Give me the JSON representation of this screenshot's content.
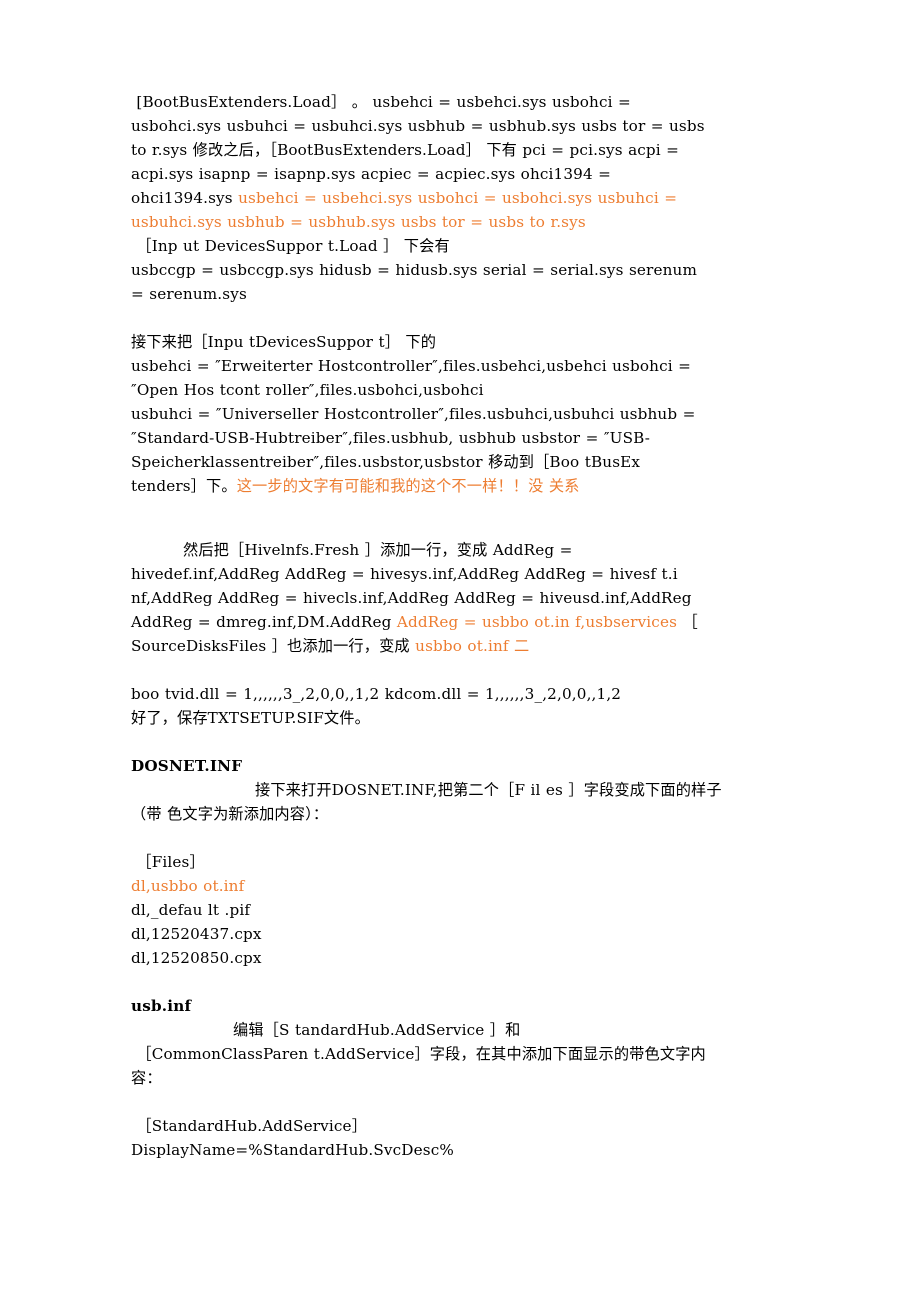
{
  "document": {
    "colors": {
      "text": "#000000",
      "highlight_orange": "#ED7D31",
      "background": "#FFFFFF"
    },
    "blocks": [
      {
        "id": "p1",
        "type": "paragraph",
        "lines": [
          {
            "runs": [
              {
                "text": " [BootBusExtenders.Load］ 。 usbehci = usbehci.sys usbohci =",
                "color": "text"
              }
            ]
          },
          {
            "runs": [
              {
                "text": "usbohci.sys usbuhci = usbuhci.sys usbhub = usbhub.sys usbs tor = usbs",
                "color": "text"
              }
            ]
          },
          {
            "runs": [
              {
                "text": "to r.sys 修改之后，［BootBusExtenders.Load］ 下有 pci = pci.sys acpi =",
                "color": "text"
              }
            ]
          },
          {
            "runs": [
              {
                "text": "acpi.sys isapnp = isapnp.sys acpiec = acpiec.sys ohci1394 =",
                "color": "text"
              }
            ]
          },
          {
            "runs": [
              {
                "text": "ohci1394.sys ",
                "color": "text"
              },
              {
                "text": "usbehci = usbehci.sys usbohci = usbohci.sys usbuhci =",
                "color": "highlight"
              }
            ]
          },
          {
            "runs": [
              {
                "text": "usbuhci.sys usbhub = usbhub.sys usbs tor = usbs to r.sys",
                "color": "highlight"
              }
            ]
          },
          {
            "runs": [
              {
                "text": " ［Inp ut DevicesSuppor t.Load ］ 下会有",
                "color": "text"
              }
            ]
          },
          {
            "runs": [
              {
                "text": "usbccgp = usbccgp.sys hidusb = hidusb.sys serial = serial.sys serenum",
                "color": "text"
              }
            ]
          },
          {
            "runs": [
              {
                "text": "= serenum.sys",
                "color": "text"
              }
            ]
          }
        ]
      },
      {
        "id": "p2",
        "type": "paragraph",
        "lines": [
          {
            "runs": [
              {
                "text": "接下来把［Inpu tDevicesSuppor t］ 下的",
                "color": "text"
              }
            ]
          },
          {
            "runs": [
              {
                "text": "usbehci = ″Erweiterter Hostcontroller″,files.usbehci,usbehci usbohci =",
                "color": "text"
              }
            ]
          },
          {
            "runs": [
              {
                "text": "″Open Hos tcont roller″,files.usbohci,usbohci",
                "color": "text"
              }
            ]
          },
          {
            "runs": [
              {
                "text": "usbuhci = ″Universeller Hostcontroller″,files.usbuhci,usbuhci usbhub =",
                "color": "text"
              }
            ]
          },
          {
            "runs": [
              {
                "text": "″Standard-USB-Hubtreiber″,files.usbhub, usbhub usbstor = ″USB-",
                "color": "text"
              }
            ]
          },
          {
            "runs": [
              {
                "text": "Speicherklassentreiber″,files.usbstor,usbstor 移动到［Boo tBusEx",
                "color": "text"
              }
            ]
          },
          {
            "runs": [
              {
                "text": "tenders］下。",
                "color": "text"
              },
              {
                "text": "这一步的文字有可能和我的这个不一样！！没 关系",
                "color": "highlight"
              }
            ]
          }
        ]
      },
      {
        "id": "p3",
        "type": "paragraph",
        "lines": [
          {
            "runs": [
              {
                "text": "然后把［Hivelnfs.Fresh ］添加一行，变成 AddReg =",
                "color": "text",
                "lead": "tab"
              }
            ]
          },
          {
            "runs": [
              {
                "text": "hivedef.inf,AddReg AddReg = hivesys.inf,AddReg AddReg = hivesf t.i",
                "color": "text"
              }
            ]
          },
          {
            "runs": [
              {
                "text": "nf,AddReg AddReg = hivecls.inf,AddReg AddReg = hiveusd.inf,AddReg",
                "color": "text"
              }
            ]
          },
          {
            "runs": [
              {
                "text": "AddReg = dmreg.inf,DM.AddReg ",
                "color": "text"
              },
              {
                "text": "AddReg = usbbo ot.in f,usbservices",
                "color": "highlight"
              },
              {
                "text": " ［",
                "color": "text"
              }
            ]
          },
          {
            "runs": [
              {
                "text": "SourceDisksFiles ］也添加一行，变成 ",
                "color": "text"
              },
              {
                "text": "usbbo ot.inf 二",
                "color": "highlight"
              }
            ]
          }
        ]
      },
      {
        "id": "p4",
        "type": "paragraph",
        "lines": [
          {
            "runs": [
              {
                "text": "boo tvid.dll = 1,,,,,,3_,2,0,0,,1,2 kdcom.dll = 1,,,,,,3_,2,0,0,,1,2",
                "color": "text"
              }
            ]
          },
          {
            "runs": [
              {
                "text": "好了，保存TXTSETUP.SIF文件。",
                "color": "text"
              }
            ]
          }
        ]
      },
      {
        "id": "h1",
        "type": "heading",
        "text": "DOSNET.INF"
      },
      {
        "id": "p5",
        "type": "paragraph",
        "lines": [
          {
            "runs": [
              {
                "text": "接下来打开DOSNET.INF,把第二个［F il es ］字段变成下面的样子",
                "color": "text",
                "lead": "tab-lg"
              }
            ]
          },
          {
            "runs": [
              {
                "text": "（带 色文字为新添加内容）：",
                "color": "text"
              }
            ]
          }
        ]
      },
      {
        "id": "p6",
        "type": "paragraph",
        "lines": [
          {
            "runs": [
              {
                "text": " ［Files］",
                "color": "text"
              }
            ]
          },
          {
            "runs": [
              {
                "text": "dl,usbbo ot.inf",
                "color": "highlight"
              }
            ]
          },
          {
            "runs": [
              {
                "text": "dl,_defau lt .pif",
                "color": "text"
              }
            ]
          },
          {
            "runs": [
              {
                "text": "dl,12520437.cpx",
                "color": "text"
              }
            ]
          },
          {
            "runs": [
              {
                "text": "dl,12520850.cpx",
                "color": "text"
              }
            ]
          }
        ]
      },
      {
        "id": "h2",
        "type": "heading",
        "text": "usb.inf"
      },
      {
        "id": "p7",
        "type": "paragraph",
        "lines": [
          {
            "runs": [
              {
                "text": "编辑［S tandardHub.AddService ］和",
                "color": "text",
                "lead": "tab-md"
              }
            ]
          },
          {
            "runs": [
              {
                "text": " ［CommonClassParen t.AddService］字段，在其中添加下面显示的带色文字内",
                "color": "text"
              }
            ]
          },
          {
            "runs": [
              {
                "text": "容：",
                "color": "text"
              }
            ]
          }
        ]
      },
      {
        "id": "p8",
        "type": "paragraph",
        "lines": [
          {
            "runs": [
              {
                "text": " ［StandardHub.AddService］",
                "color": "text"
              }
            ]
          },
          {
            "runs": [
              {
                "text": "DisplayName=%StandardHub.SvcDesc%",
                "color": "text"
              }
            ]
          }
        ]
      }
    ]
  }
}
